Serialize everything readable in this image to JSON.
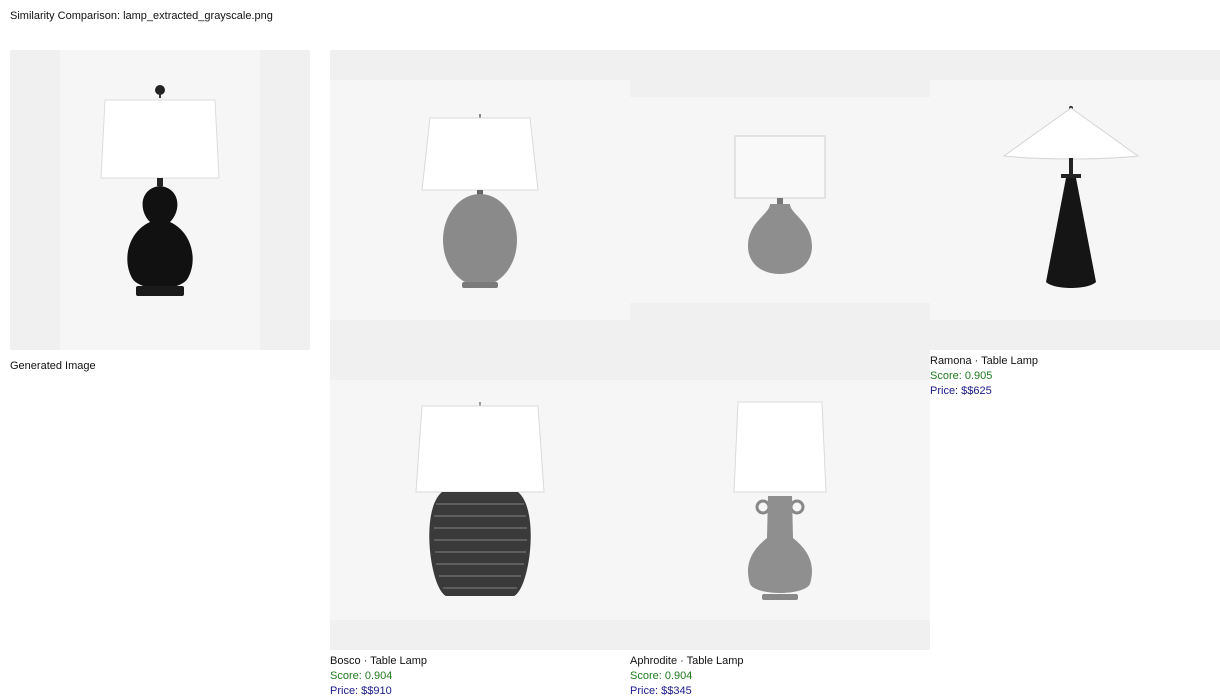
{
  "page": {
    "title": "Similarity Comparison: lamp_extracted_grayscale.png"
  },
  "generated": {
    "label": "Generated Image",
    "icon": "gourd-table-lamp-image"
  },
  "results": [
    {
      "name": "Ramona · Table Lamp",
      "score": "Score: 0.905",
      "price": "Price: $$625",
      "icon": "cone-shade-lamp-image"
    },
    {
      "name": "Bosco · Table Lamp",
      "score": "Score: 0.904",
      "price": "Price: $$910",
      "icon": "ribbed-vase-lamp-image"
    },
    {
      "name": "Aphrodite · Table Lamp",
      "score": "Score: 0.904",
      "price": "Price: $$345",
      "icon": "amphora-lamp-image"
    }
  ],
  "colors": {
    "score": "#1f7a1f",
    "price": "#1a1a8a",
    "panel": "#f0f0f0"
  }
}
